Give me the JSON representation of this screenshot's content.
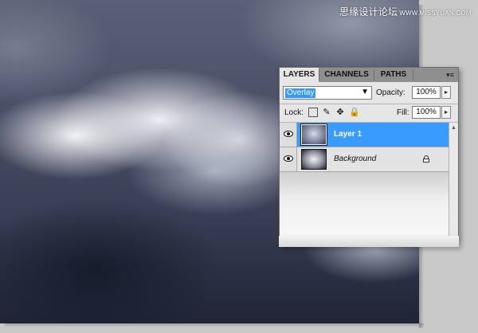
{
  "watermark": {
    "cn": "思缘设计论坛",
    "url": "WWW.MISSYUAN.COM"
  },
  "panel": {
    "tabs": [
      "LAYERS",
      "CHANNELS",
      "PATHS"
    ],
    "menu_icon": "panel-menu-icon",
    "blend_mode": {
      "value": "Overlay",
      "arrow": "▼"
    },
    "opacity": {
      "label": "Opacity:",
      "value": "100%"
    },
    "lock": {
      "label": "Lock:",
      "icons": [
        "lock-transparent-icon",
        "brush-icon",
        "move-icon",
        "lock-icon"
      ]
    },
    "fill": {
      "label": "Fill:",
      "value": "100%"
    },
    "stepper_arrow": "▸",
    "layers": [
      {
        "name": "Layer 1",
        "selected": true,
        "visible": true
      },
      {
        "name": "Background",
        "selected": false,
        "visible": true,
        "locked": true
      }
    ]
  },
  "colors": {
    "selection": "#3a9bff",
    "panel_bg": "#e6e6e6",
    "workspace": "#c9c9c9"
  }
}
